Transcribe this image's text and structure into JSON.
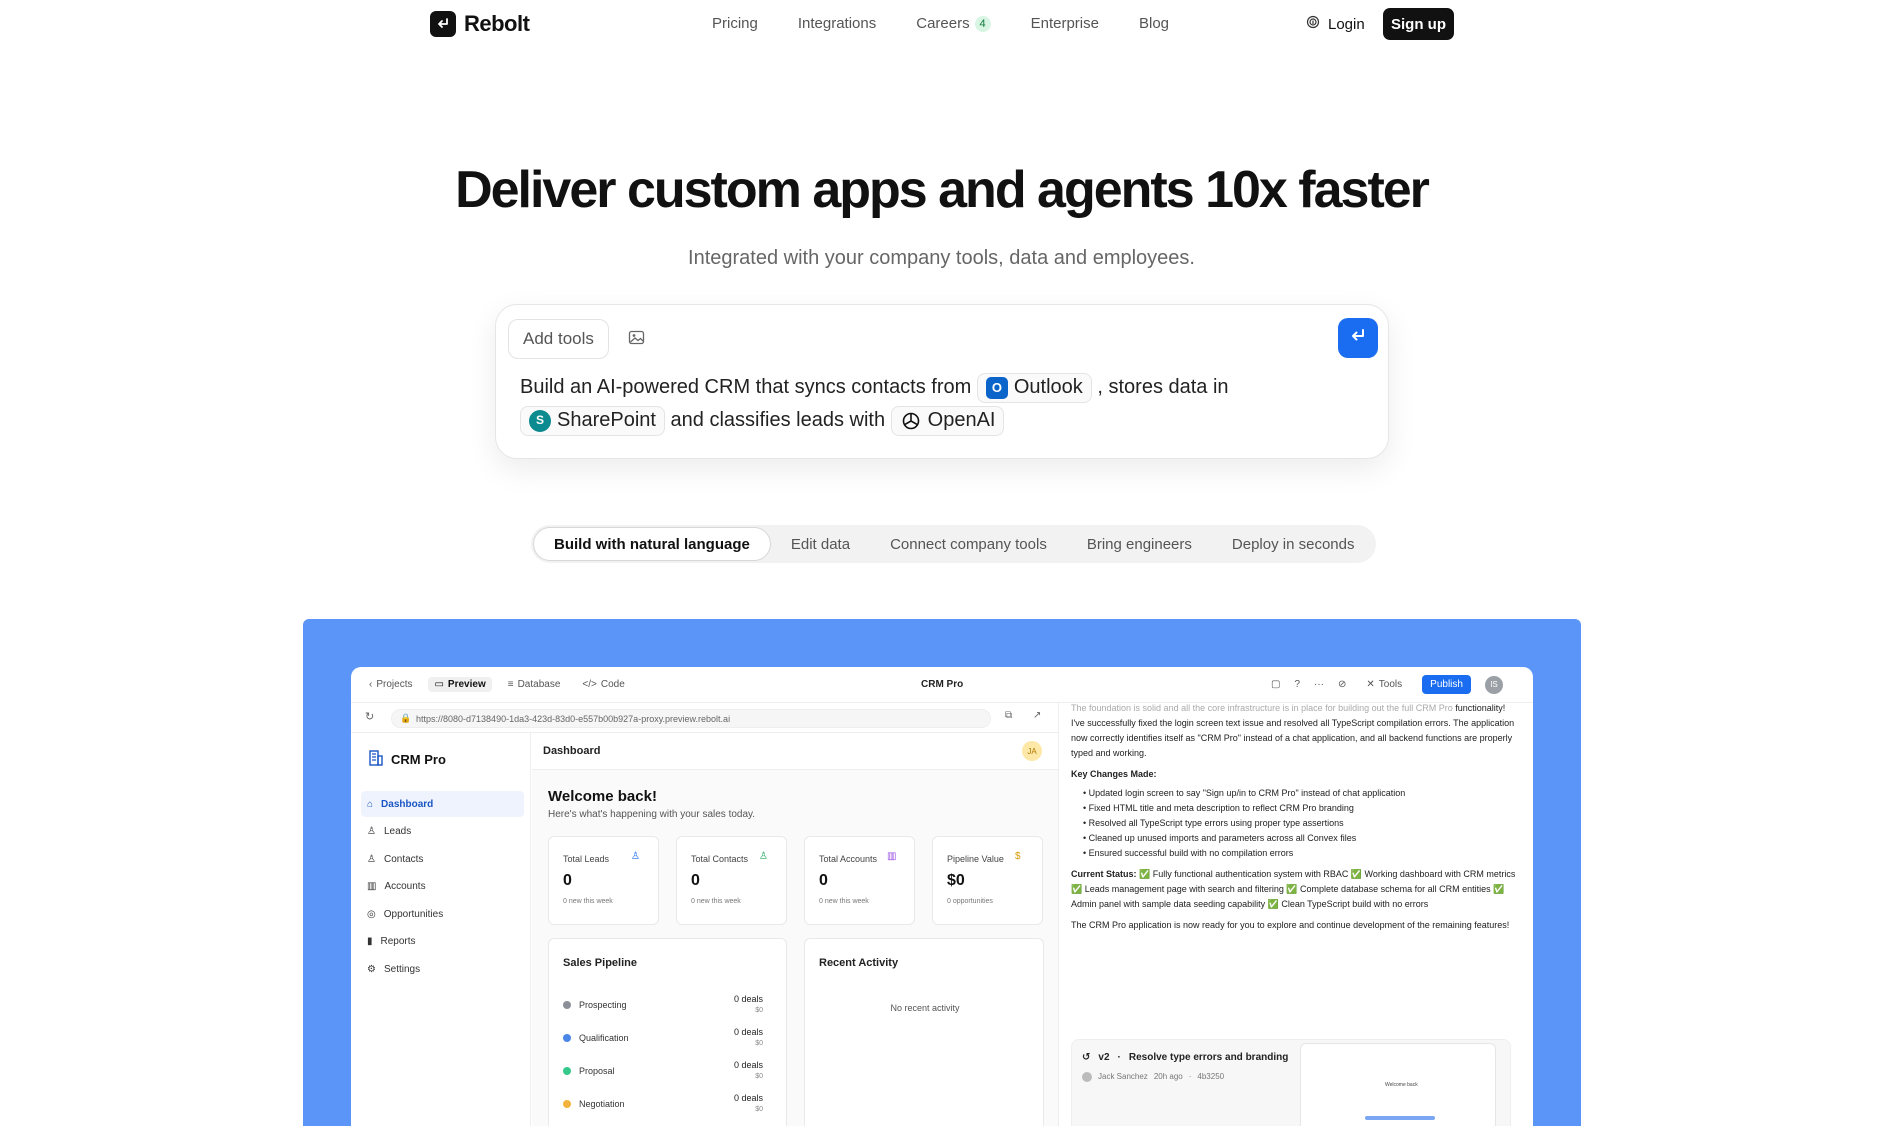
{
  "nav": {
    "brand": "Rebolt",
    "links": [
      {
        "label": "Pricing"
      },
      {
        "label": "Integrations"
      },
      {
        "label": "Careers",
        "badge": "4"
      },
      {
        "label": "Enterprise"
      },
      {
        "label": "Blog"
      }
    ],
    "login": "Login",
    "signup": "Sign up"
  },
  "hero": {
    "title": "Deliver custom apps and agents 10x faster",
    "subtitle": "Integrated with your company tools, data and employees."
  },
  "prompt": {
    "add_tools": "Add tools",
    "text_1": "Build an AI-powered CRM that syncs contacts from",
    "chip_outlook": "Outlook",
    "text_2": ", stores data in",
    "chip_sharepoint": "SharePoint",
    "text_3": "and classifies leads with",
    "chip_openai": "OpenAI"
  },
  "tabs": [
    "Build with natural language",
    "Edit data",
    "Connect company tools",
    "Bring engineers",
    "Deploy in seconds"
  ],
  "app": {
    "topbar": {
      "projects": "Projects",
      "preview": "Preview",
      "database": "Database",
      "code": "Code",
      "title": "CRM Pro",
      "tools": "Tools",
      "publish": "Publish",
      "avatar": "IS"
    },
    "url": "https://8080-d7138490-1da3-423d-83d0-e557b00b927a-proxy.preview.rebolt.ai",
    "sidebar": {
      "brand": "CRM Pro",
      "items": [
        "Dashboard",
        "Leads",
        "Contacts",
        "Accounts",
        "Opportunities",
        "Reports",
        "Settings"
      ]
    },
    "main": {
      "title": "Dashboard",
      "avatar": "JA",
      "welcome": "Welcome back!",
      "welcome_sub": "Here's what's happening with your sales today.",
      "stats": [
        {
          "label": "Total Leads",
          "value": "0",
          "note": "0 new this week"
        },
        {
          "label": "Total Contacts",
          "value": "0",
          "note": "0 new this week"
        },
        {
          "label": "Total Accounts",
          "value": "0",
          "note": "0 new this week"
        },
        {
          "label": "Pipeline Value",
          "value": "$0",
          "note": "0 opportunities"
        }
      ],
      "pipeline_title": "Sales Pipeline",
      "pipeline": [
        {
          "stage": "Prospecting",
          "deals": "0 deals",
          "amount": "$0",
          "color": "#8a8f98"
        },
        {
          "stage": "Qualification",
          "deals": "0 deals",
          "amount": "$0",
          "color": "#4a86e8"
        },
        {
          "stage": "Proposal",
          "deals": "0 deals",
          "amount": "$0",
          "color": "#34c98a"
        },
        {
          "stage": "Negotiation",
          "deals": "0 deals",
          "amount": "$0",
          "color": "#f3b33d"
        }
      ],
      "activity_title": "Recent Activity",
      "activity_empty": "No recent activity"
    },
    "chat": {
      "faded": "The foundation is solid and all the core infrastructure is in place for building out the full CRM Pro",
      "para1": "functionality! I've successfully fixed the login screen text issue and resolved all TypeScript compilation errors. The application now correctly identifies itself as \"CRM Pro\" instead of a chat application, and all backend functions are properly typed and working.",
      "key_changes": "Key Changes Made:",
      "changes": [
        "Updated login screen to say \"Sign up/in to CRM Pro\" instead of chat application",
        "Fixed HTML title and meta description to reflect CRM Pro branding",
        "Resolved all TypeScript type errors using proper type assertions",
        "Cleaned up unused imports and parameters across all Convex files",
        "Ensured successful build with no compilation errors"
      ],
      "status_label": "Current Status:",
      "status_text": "✅ Fully functional authentication system with RBAC ✅ Working dashboard with CRM metrics ✅ Leads management page with search and filtering ✅ Complete database schema for all CRM entities ✅ Admin panel with sample data seeding capability ✅ Clean TypeScript build with no errors",
      "closing": "The CRM Pro application is now ready for you to explore and continue development of the remaining features!",
      "version": {
        "tag": "v2",
        "title": "Resolve type errors and branding",
        "author": "Jack Sanchez",
        "time": "20h ago",
        "commit": "4b3250",
        "thumb_text": "Welcome back"
      }
    }
  }
}
